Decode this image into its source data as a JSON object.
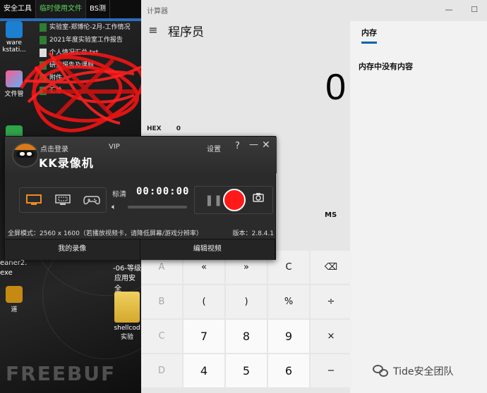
{
  "desktop": {
    "tabs": [
      {
        "label": "安全工具",
        "active": false
      },
      {
        "label": "临时使用文件",
        "active": true
      },
      {
        "label": "BS测",
        "active": false
      }
    ],
    "icons": [
      {
        "label": "ware\nkstati..."
      },
      {
        "label": "文件管"
      }
    ],
    "files": [
      {
        "name": "实验室-郑博伦-2月-工作情况",
        "type": "excel"
      },
      {
        "name": "2021年度实验室工作报告",
        "type": "excel"
      },
      {
        "name": "个人情况汇总.txt",
        "type": "txt"
      },
      {
        "name": "研究报告及课题",
        "type": "excel"
      },
      {
        "name": "附件",
        "type": "excel"
      },
      {
        "name": "汇总",
        "type": "excel"
      }
    ],
    "lower_texts": [
      "-06-等级",
      "应用安全",
      "eaner2.",
      "exe",
      "道"
    ],
    "folder_label": "shellcod\n实验",
    "watermark_bg": "FREEBUF"
  },
  "calculator": {
    "window_title": "计算器",
    "controls": {
      "minimize": "—",
      "maximize": "☐"
    },
    "menu_icon": "≡",
    "mode": "程序员",
    "display": "0",
    "hex_label": "HEX",
    "hex_value": "0",
    "ms_label": "MS",
    "memory": {
      "tab": "内存",
      "empty_message": "内存中没有内容"
    },
    "keys": [
      {
        "label": "A",
        "disabled": true,
        "num": false
      },
      {
        "label": "«",
        "disabled": false,
        "num": false
      },
      {
        "label": "»",
        "disabled": false,
        "num": false
      },
      {
        "label": "C",
        "disabled": false,
        "num": false
      },
      {
        "label": "⌫",
        "disabled": false,
        "num": false
      },
      {
        "label": "B",
        "disabled": true,
        "num": false
      },
      {
        "label": "(",
        "disabled": false,
        "num": false
      },
      {
        "label": ")",
        "disabled": false,
        "num": false
      },
      {
        "label": "%",
        "disabled": false,
        "num": false
      },
      {
        "label": "÷",
        "disabled": false,
        "num": false
      },
      {
        "label": "C",
        "disabled": true,
        "num": false
      },
      {
        "label": "7",
        "disabled": false,
        "num": true
      },
      {
        "label": "8",
        "disabled": false,
        "num": true
      },
      {
        "label": "9",
        "disabled": false,
        "num": true
      },
      {
        "label": "×",
        "disabled": false,
        "num": false
      },
      {
        "label": "D",
        "disabled": true,
        "num": false
      },
      {
        "label": "4",
        "disabled": false,
        "num": true
      },
      {
        "label": "5",
        "disabled": false,
        "num": true
      },
      {
        "label": "6",
        "disabled": false,
        "num": true
      },
      {
        "label": "−",
        "disabled": false,
        "num": false
      }
    ]
  },
  "recorder": {
    "login": "点击登录",
    "vip": "VIP",
    "app_name": "KK录像机",
    "settings": "设置",
    "help": "?",
    "minimize": "—",
    "close": "✕",
    "quality": "标清",
    "timer": "00:00:00",
    "mode_info": "全屏模式：2560 x 1600（若播放视频卡，请降低屏幕/游戏分辨率）",
    "version": "版本：2.8.4.1",
    "bottom_tabs": [
      "我的录像",
      "编辑视频"
    ],
    "accent_color": "#ff1a1a",
    "source_active_color": "#f08a24"
  },
  "watermark": {
    "text": "Tide安全团队"
  }
}
